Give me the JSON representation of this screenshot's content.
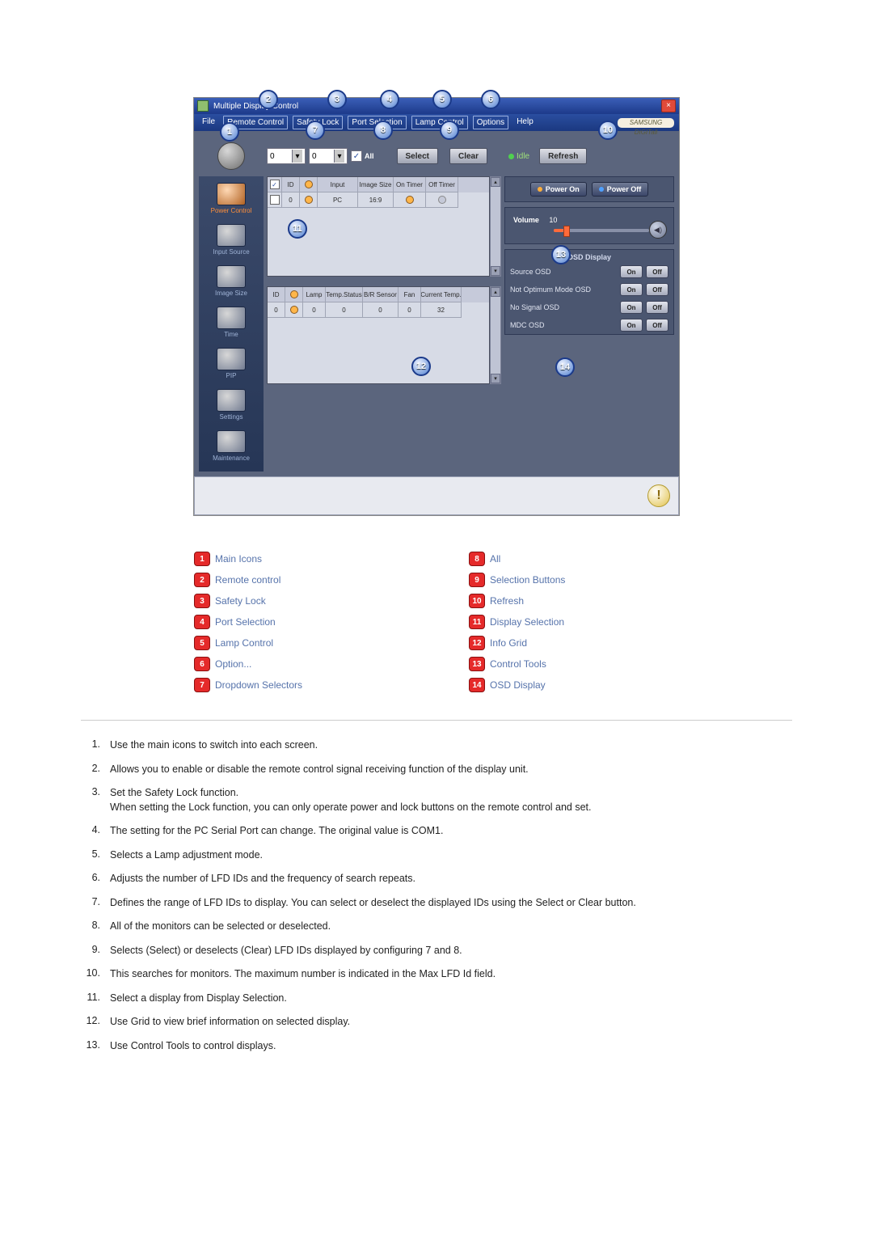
{
  "app": {
    "title": "Multiple Display Control",
    "brand": "SAMSUNG DIGITall",
    "close": "×"
  },
  "menus": {
    "file": "File",
    "remote": "Remote Control",
    "safety": "Safety Lock",
    "port": "Port Selection",
    "lamp": "Lamp Control",
    "options": "Options",
    "help": "Help"
  },
  "toolbar": {
    "sel1": "0",
    "sel2": "0",
    "all": "All",
    "select": "Select",
    "clear": "Clear",
    "idle": "Idle",
    "refresh": "Refresh"
  },
  "sidebar": {
    "items": [
      {
        "label": "Power Control"
      },
      {
        "label": "Input Source"
      },
      {
        "label": "Image Size"
      },
      {
        "label": "Time"
      },
      {
        "label": "PIP"
      },
      {
        "label": "Settings"
      },
      {
        "label": "Maintenance"
      }
    ]
  },
  "grid1": {
    "headers": [
      "",
      "ID",
      "",
      "Input",
      "Image Size",
      "On Timer",
      "Off Timer"
    ],
    "row": {
      "id": "0",
      "input": "PC",
      "size": "16:9"
    }
  },
  "grid2": {
    "headers": [
      "ID",
      "",
      "Lamp",
      "Temp.Status",
      "B/R Sensor",
      "Fan",
      "Current Temp."
    ],
    "row": {
      "id": "0",
      "lamp": "0",
      "temp": "0",
      "br": "0",
      "fan": "0",
      "cur": "32"
    }
  },
  "power": {
    "on": "Power On",
    "off": "Power Off"
  },
  "volume": {
    "label": "Volume",
    "value": "10"
  },
  "osd": {
    "title": "OSD Display",
    "on": "On",
    "off": "Off",
    "rows": [
      {
        "label": "Source OSD"
      },
      {
        "label": "Not Optimum Mode OSD"
      },
      {
        "label": "No Signal OSD"
      },
      {
        "label": "MDC OSD"
      }
    ]
  },
  "info_icon": "!",
  "legend": {
    "left": [
      {
        "n": "1",
        "t": "Main Icons"
      },
      {
        "n": "2",
        "t": "Remote control"
      },
      {
        "n": "3",
        "t": "Safety Lock"
      },
      {
        "n": "4",
        "t": "Port Selection"
      },
      {
        "n": "5",
        "t": "Lamp Control"
      },
      {
        "n": "6",
        "t": "Option..."
      },
      {
        "n": "7",
        "t": "Dropdown Selectors"
      }
    ],
    "right": [
      {
        "n": "8",
        "t": "All"
      },
      {
        "n": "9",
        "t": "Selection Buttons"
      },
      {
        "n": "10",
        "t": "Refresh"
      },
      {
        "n": "11",
        "t": "Display Selection"
      },
      {
        "n": "12",
        "t": "Info Grid"
      },
      {
        "n": "13",
        "t": "Control Tools"
      },
      {
        "n": "14",
        "t": "OSD Display"
      }
    ]
  },
  "desc": [
    {
      "n": "1.",
      "t": "Use the main icons to switch into each screen."
    },
    {
      "n": "2.",
      "t": "Allows you to enable or disable the remote control signal receiving function of the display unit."
    },
    {
      "n": "3.",
      "t": "Set the Safety Lock function.\nWhen setting the Lock function, you can only operate power and lock buttons on the remote control and set."
    },
    {
      "n": "4.",
      "t": "The setting for the PC Serial Port can change. The original value is COM1."
    },
    {
      "n": "5.",
      "t": "Selects a Lamp adjustment mode."
    },
    {
      "n": "6.",
      "t": "Adjusts the number of LFD IDs and the frequency of search repeats."
    },
    {
      "n": "7.",
      "t": "Defines the range of LFD IDs to display. You can select or deselect the displayed IDs using the Select or Clear button."
    },
    {
      "n": "8.",
      "t": "All of the monitors can be selected or deselected."
    },
    {
      "n": "9.",
      "t": "Selects (Select) or deselects (Clear) LFD IDs displayed by configuring 7 and 8."
    },
    {
      "n": "10.",
      "t": "This searches for monitors. The maximum number is indicated in the Max LFD Id field."
    },
    {
      "n": "11.",
      "t": "Select a display from Display Selection."
    },
    {
      "n": "12.",
      "t": "Use Grid to view brief information on selected display."
    },
    {
      "n": "13.",
      "t": "Use Control Tools to control displays."
    }
  ]
}
